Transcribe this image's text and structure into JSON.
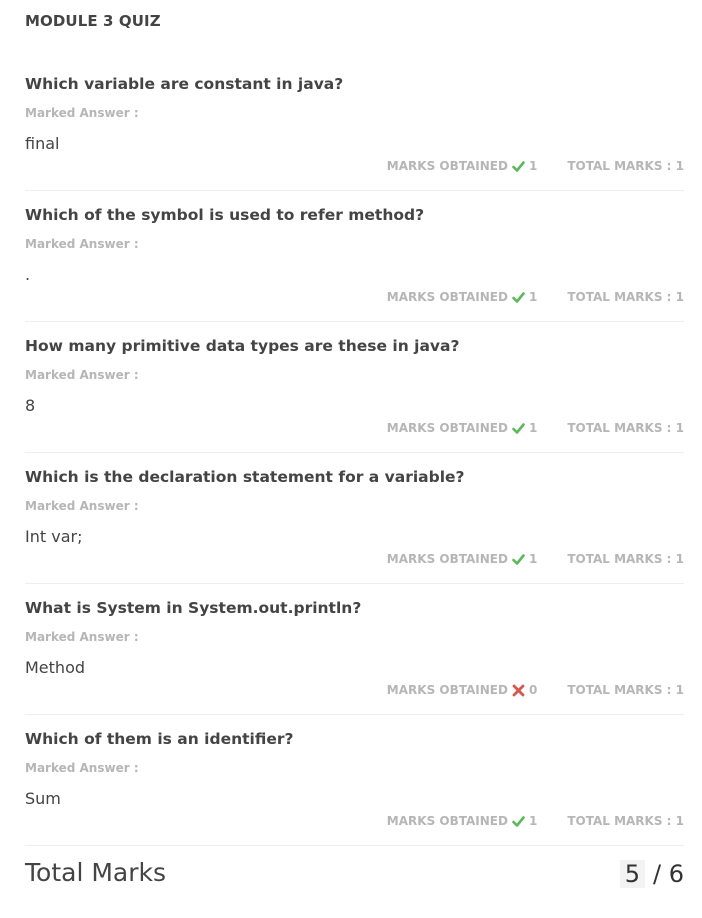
{
  "quiz_title": "MODULE 3 QUIZ",
  "labels": {
    "marked_answer": "Marked Answer :",
    "marks_obtained": "MARKS OBTAINED",
    "total_marks_prefix": "TOTAL MARKS :"
  },
  "questions": [
    {
      "question": "Which variable are constant in java?",
      "answer": "final",
      "correct": true,
      "marks_obtained": "1",
      "total_marks": "1"
    },
    {
      "question": "Which of the symbol is used to refer method?",
      "answer": ".",
      "correct": true,
      "marks_obtained": "1",
      "total_marks": "1"
    },
    {
      "question": "How many primitive data types are these in java?",
      "answer": "8",
      "correct": true,
      "marks_obtained": "1",
      "total_marks": "1"
    },
    {
      "question": "Which is the declaration statement for a variable?",
      "answer": "Int var;",
      "correct": true,
      "marks_obtained": "1",
      "total_marks": "1"
    },
    {
      "question": "What is System in System.out.println?",
      "answer": "Method",
      "correct": false,
      "marks_obtained": "0",
      "total_marks": "1"
    },
    {
      "question": "Which of them is an identifier?",
      "answer": "Sum",
      "correct": true,
      "marks_obtained": "1",
      "total_marks": "1"
    }
  ],
  "total": {
    "label": "Total Marks",
    "obtained": "5",
    "out_of": "/ 6"
  },
  "colors": {
    "correct": "#5cb85c",
    "wrong": "#d9534f",
    "muted": "#b6b6b6",
    "text": "#444444"
  },
  "icons": {
    "correct": "check-icon",
    "wrong": "cross-icon"
  }
}
